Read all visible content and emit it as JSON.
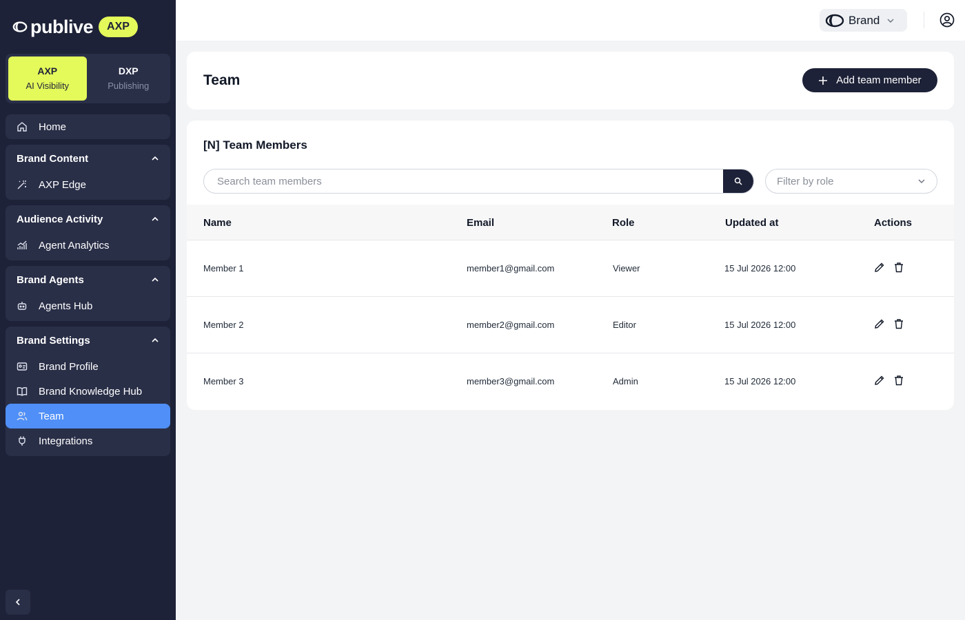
{
  "app": {
    "logo_text": "publive",
    "logo_badge": "AXP"
  },
  "modes": [
    {
      "title": "AXP",
      "subtitle": "AI Visibility",
      "active": true
    },
    {
      "title": "DXP",
      "subtitle": "Publishing",
      "active": false
    }
  ],
  "sidebar": {
    "home": {
      "label": "Home",
      "icon": "home-icon"
    },
    "groups": [
      {
        "title": "Brand Content",
        "items": [
          {
            "label": "AXP Edge",
            "icon": "magic-wand-icon"
          }
        ]
      },
      {
        "title": "Audience Activity",
        "items": [
          {
            "label": "Agent Analytics",
            "icon": "analytics-icon"
          }
        ]
      },
      {
        "title": "Brand Agents",
        "items": [
          {
            "label": "Agents Hub",
            "icon": "robot-icon"
          }
        ]
      },
      {
        "title": "Brand Settings",
        "items": [
          {
            "label": "Brand Profile",
            "icon": "id-card-icon"
          },
          {
            "label": "Brand Knowledge Hub",
            "icon": "book-icon"
          },
          {
            "label": "Team",
            "icon": "users-icon",
            "active": true
          },
          {
            "label": "Integrations",
            "icon": "plug-icon"
          }
        ]
      }
    ]
  },
  "topbar": {
    "brand_label": "Brand"
  },
  "page": {
    "title": "Team",
    "add_button_label": "Add team member"
  },
  "members": {
    "title": "[N] Team Members",
    "search_placeholder": "Search team members",
    "filter_placeholder": "Filter by role",
    "columns": [
      "Name",
      "Email",
      "Role",
      "Updated at",
      "Actions"
    ],
    "rows": [
      {
        "name": "Member 1",
        "email": "member1@gmail.com",
        "role": "Viewer",
        "updated_at": "15 Jul 2026 12:00"
      },
      {
        "name": "Member 2",
        "email": "member2@gmail.com",
        "role": "Editor",
        "updated_at": "15 Jul 2026 12:00"
      },
      {
        "name": "Member 3",
        "email": "member3@gmail.com",
        "role": "Admin",
        "updated_at": "15 Jul 2026 12:00"
      }
    ]
  },
  "colors": {
    "sidebar_bg": "#1e2238",
    "accent_lime": "#e4f95a",
    "active_blue": "#4f8ff7"
  }
}
